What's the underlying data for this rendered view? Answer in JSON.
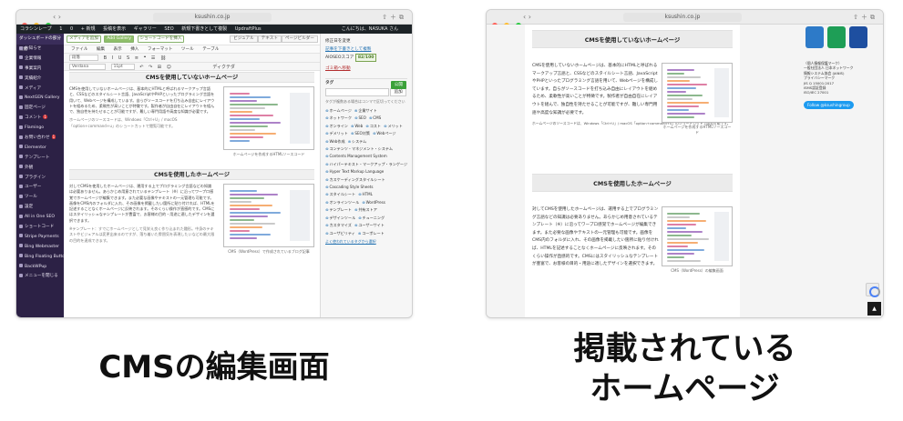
{
  "colors": {
    "traffic_red": "#ff5f57",
    "traffic_yellow": "#febc2e",
    "traffic_green": "#28c840",
    "wp_sidebar": "#2c2145",
    "wp_adminbar": "#1d2327",
    "wp_link": "#2271b1",
    "publish_green": "#3ba13a",
    "twitter_blue": "#1d9bf0"
  },
  "left_window": {
    "url": "ksushin.co.jp",
    "adminbar": {
      "items": [
        "コラシンレープ",
        "1",
        "0",
        "+ 新規",
        "投稿を表示",
        "ギャラリー",
        "SEO",
        "新規下書きとして複製",
        "UpdraftPlus"
      ],
      "greeting": "こんにちは、NASUKA さん"
    },
    "sidebar": {
      "site_label": "ダッシュボードの部分機能",
      "items": [
        {
          "label": "お知らせ",
          "badge": ""
        },
        {
          "label": "企業情報",
          "badge": ""
        },
        {
          "label": "事業案内",
          "badge": ""
        },
        {
          "label": "実績紹介",
          "badge": ""
        },
        {
          "label": "メディア",
          "badge": ""
        },
        {
          "label": "NextGEN Gallery",
          "badge": ""
        },
        {
          "label": "固定ページ",
          "badge": ""
        },
        {
          "label": "コメント",
          "badge": "1"
        },
        {
          "label": "Flamingo",
          "badge": ""
        },
        {
          "label": "お問い合わせ",
          "badge": "1"
        },
        {
          "label": "Elementor",
          "badge": ""
        },
        {
          "label": "テンプレート",
          "badge": ""
        },
        {
          "label": "外観",
          "badge": ""
        },
        {
          "label": "プラグイン",
          "badge": ""
        },
        {
          "label": "ユーザー",
          "badge": ""
        },
        {
          "label": "ツール",
          "badge": ""
        },
        {
          "label": "設定",
          "badge": ""
        },
        {
          "label": "All in One SEO",
          "badge": ""
        },
        {
          "label": "ショートコード",
          "badge": ""
        },
        {
          "label": "Stripe Payments",
          "badge": ""
        },
        {
          "label": "Bing Webmaster",
          "badge": ""
        },
        {
          "label": "Bing Floating Button",
          "badge": ""
        },
        {
          "label": "BackWPup",
          "badge": ""
        },
        {
          "label": "メニューを閉じる",
          "badge": ""
        }
      ]
    },
    "editor": {
      "buttons": [
        "メディアを追加",
        "Add Gallery",
        "ショートコードを挿入"
      ],
      "view_tabs": [
        "ビジュアル",
        "テキスト",
        "ページビルダー"
      ],
      "menus": [
        "ファイル",
        "編集",
        "表示",
        "挿入",
        "フォーマット",
        "ツール",
        "テーブル"
      ],
      "format_select": "段落",
      "font_select": "Verdana",
      "size_select": "11pt",
      "dictate_label": "ディクテダ",
      "sections": [
        {
          "heading": "CMSを使用していないホームページ",
          "body": "CMSを使用していないホームページは、基本的にHTMLと呼ばれるマークアップ言語と、CSSなどのスタイルシート言語、JavaScriptやPHPといったプログラミング言語を用いて、Webページを構成しています。自らがソースコードを打ち込み自由にレイアウトを組めるため、柔軟性が高いことが特徴です。製作者が自由自在にレイアウトを組んで、独自性を持たせることが可能ですが、難しい専門用語や高度な知識が必要です。",
          "note": "ホームページのソースコードは、Windows「Ctrl+U」/ macOS「option+command+u」のショートカットで閲覧可能です。",
          "image_caption": "ホームページを作成するHTMLソースコード"
        },
        {
          "heading": "CMSを使用したホームページ",
          "body": "対してCMSを使用したホームページは、運用する上でプログラミング言語などの知識は必要ありません。あらかじめ用意されているテンプレート（※）に沿ってワープロ感覚でホームページが編集できます。また必要な画像やテキストの一元管理も可能です。画像をCMS内のフォルダに入れ、その画像を掲載したい箇所に貼り付ければ、HTMLを記述することなくホームページに反映されます。そのくらい操作が直感的です。CMSにはスタイリッシュなテンプレートが豊富で、お客様の目的・用途に適したデザインを選択できます。",
          "note": "※テンプレート：すでにホームページとして見栄え良く作り込まれた雛形。中身のテキストやビジュアルは変更出来るのですが、落ち着いた雰囲気を表現したいなどの最大限の目的を達成できます。",
          "image_caption": "CMS（WordPress）で作成されているブログ記事"
        }
      ]
    },
    "right_panel": {
      "line1": "修正日を変更",
      "line2": "記事を下書きとして複製",
      "seo_label": "AIOSEOスコア",
      "seo_score": "82/100",
      "trash_link": "ゴミ箱へ移動",
      "publish_button": "公開",
      "tag_box_title": "タグ",
      "add_button": "追加",
      "tag_hint": "タグが複数ある場合はコンマで区切ってください",
      "tags": [
        "ホームページ",
        "企業サイト",
        "ネットワーク",
        "SEO",
        "CMS",
        "オンライン",
        "Web",
        "コスト",
        "メリット",
        "デメリット",
        "SEO対策",
        "Webページ",
        "Web作成",
        "システム",
        "コンテンツ・マネジメント・システム",
        "Contents Management System",
        "ハイパーテキスト・マークアップ・ランゲージ",
        "Hyper Text Markup Language",
        "カスケーディングスタイルシート",
        "Cascading Style Sheets",
        "スタイルシート",
        "HTML",
        "オンラインツール",
        "WordPress",
        "テンプレート",
        "共有ストア",
        "デザインツール",
        "チューニング",
        "カスタマイズ",
        "ユーザーサイト",
        "ユーザビリティ",
        "コーポレート"
      ],
      "footer_link": "よく使われているタグから選択"
    }
  },
  "right_window": {
    "url": "ksushin.co.jp",
    "sections": [
      {
        "heading": "CMSを使用していないホームページ",
        "body": "CMSを使用していないホームページは、基本的にHTMLと呼ばれるマークアップ言語と、CSSなどのスタイルシート言語、JavaScriptやPHPといったプログラミング言語を用いて、Webページを構成しています。自らがソースコードを打ち込み自由にレイアウトを組めるため、柔軟性が高いことが特徴です。製作者が自由自在にレイアウトを組んで、独自性を持たせることが可能ですが、難しい専門用語や高度な知識が必要です。",
        "note": "ホームページのソースコードは、Windows「Ctrl+U」/ macOS「option+command+u」のショートカットで閲覧可能です。",
        "image_caption": "ホームページを作成するHTMLソースコード"
      },
      {
        "heading": "CMSを使用したホームページ",
        "body": "対してCMSを使用したホームページは、運用する上でプログラミング言語などの知識は必要ありません。あらかじめ用意されているテンプレート（※）に沿ってワープロ感覚でホームページが編集できます。また必要な画像やテキストの一元管理も可能です。画像をCMS内のフォルダに入れ、その画像を掲載したい箇所に貼り付ければ、HTMLを記述することなくホームページに反映されます。そのくらい操作が直感的です。CMSにはスタイリッシュなテンプレートが豊富で、お客様の目的・用途に適したデザインを選択できます。",
        "note": "",
        "image_caption": "CMS（WordPress）の編集画面"
      }
    ],
    "sidebar_lines": [
      "（個人情報保護マーク）",
      "一般社団法人 日本ネットワーク",
      "情報システム協会 (JANIS)",
      "プライバシーマーク",
      "JIS Q 15001:2017",
      "ISMS認証登録",
      "ISO/IEC 27001"
    ],
    "follow_label": "Follow @ksushingroup"
  },
  "captions": {
    "left": "CMSの編集画面",
    "right_line1": "掲載されている",
    "right_line2": "ホームページ"
  }
}
